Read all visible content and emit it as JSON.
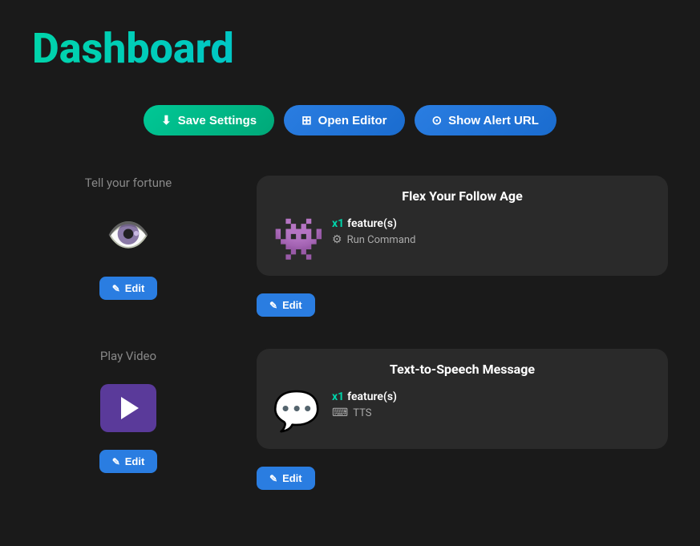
{
  "page": {
    "title": "Dashboard"
  },
  "toolbar": {
    "save_label": "Save Settings",
    "editor_label": "Open Editor",
    "alert_url_label": "Show Alert URL"
  },
  "rows": [
    {
      "id": "row1",
      "left": {
        "label": "Tell your fortune",
        "icon_type": "eye",
        "edit_label": "Edit"
      },
      "right": {
        "title": "Flex Your Follow Age",
        "multiplier": "x1",
        "feature": "feature(s)",
        "action_type": "command",
        "action_label": "Run Command",
        "icon_type": "monster",
        "edit_label": "Edit"
      }
    },
    {
      "id": "row2",
      "left": {
        "label": "Play Video",
        "icon_type": "video",
        "edit_label": "Edit"
      },
      "right": {
        "title": "Text-to-Speech Message",
        "multiplier": "x1",
        "feature": "feature(s)",
        "action_type": "tts",
        "action_label": "TTS",
        "icon_type": "speech",
        "edit_label": "Edit"
      }
    }
  ]
}
